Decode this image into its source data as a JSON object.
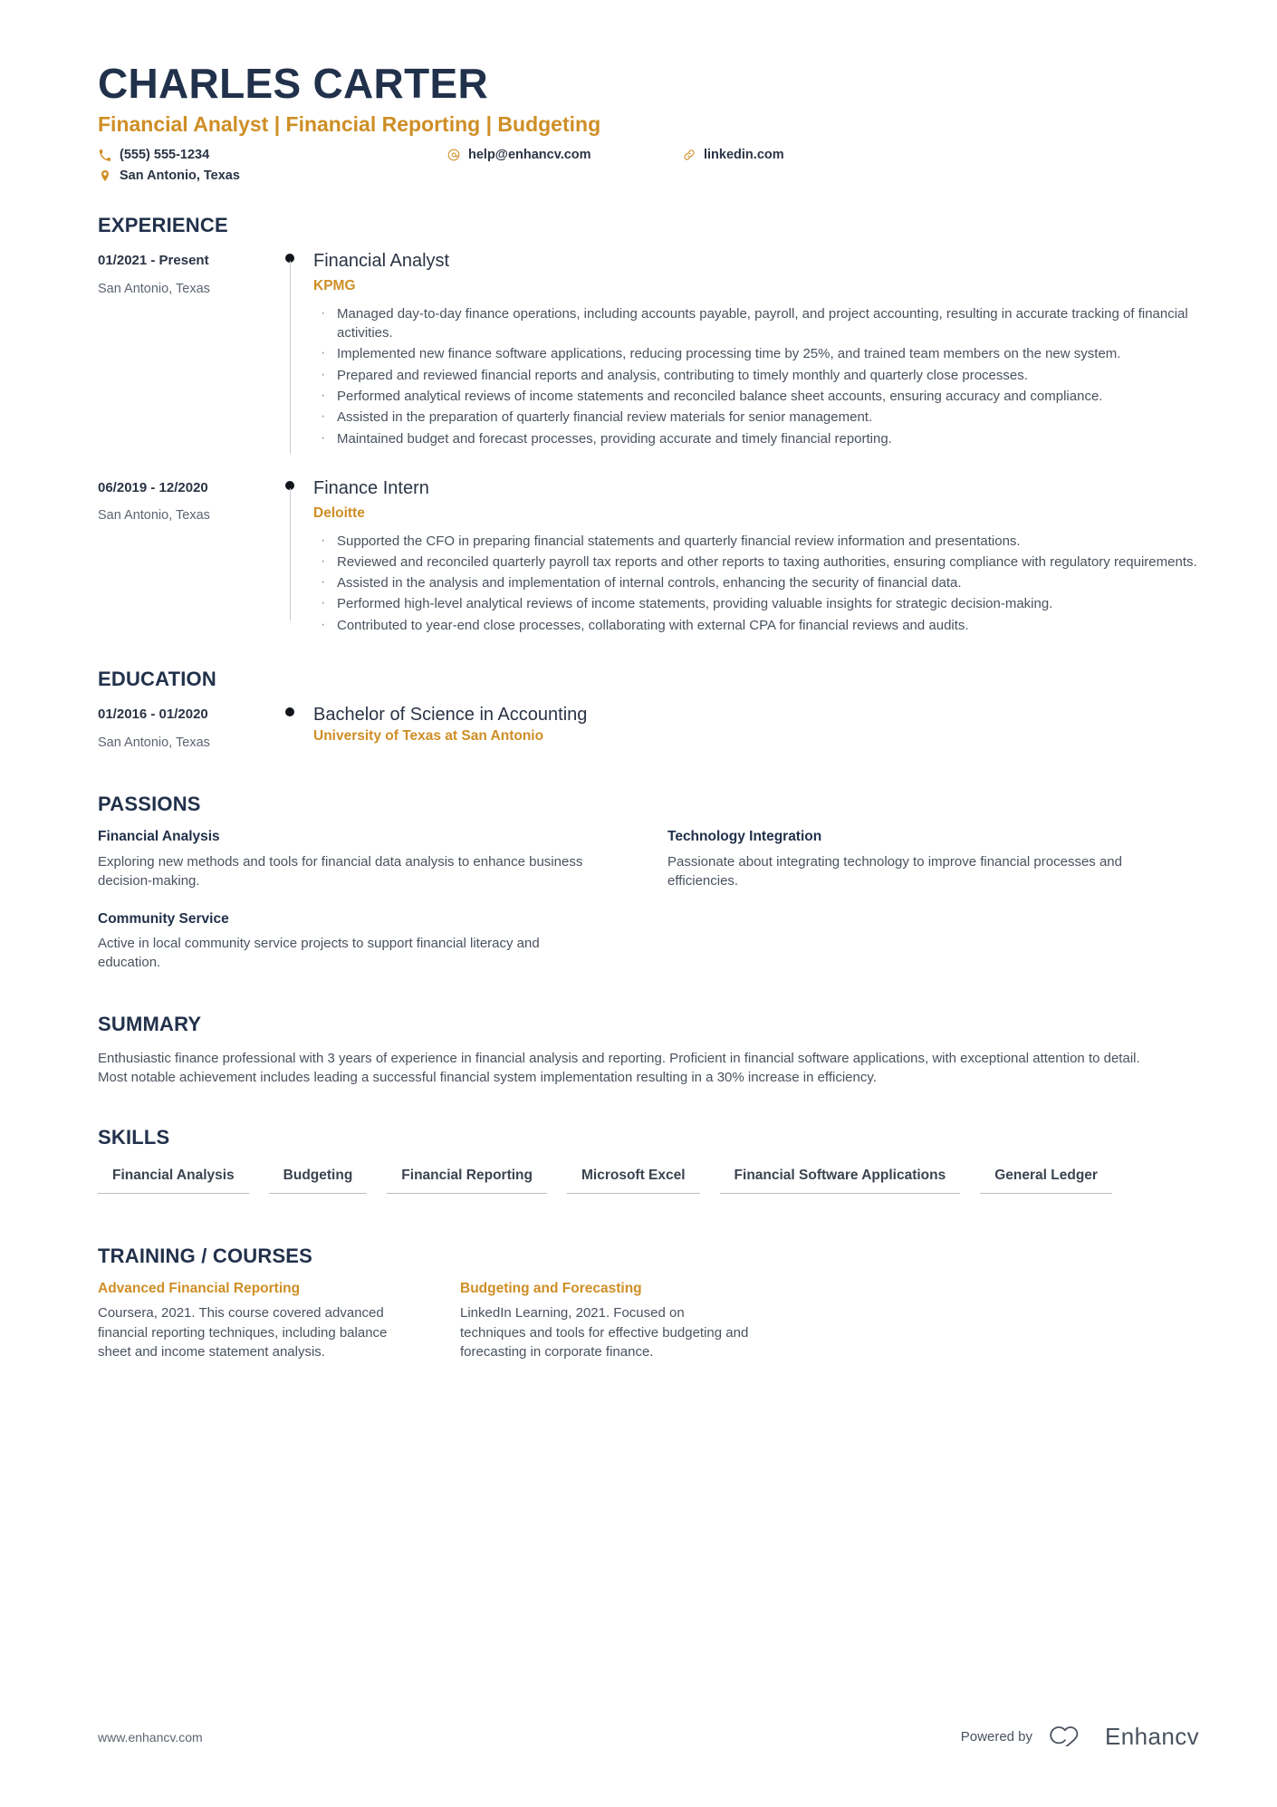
{
  "header": {
    "name": "CHARLES CARTER",
    "tagline": "Financial Analyst | Financial Reporting | Budgeting",
    "contacts": [
      {
        "icon": "phone-icon",
        "value": "(555) 555-1234"
      },
      {
        "icon": "email-icon",
        "value": "help@enhancv.com"
      },
      {
        "icon": "link-icon",
        "value": "linkedin.com"
      },
      {
        "icon": "location-icon",
        "value": "San Antonio, Texas"
      }
    ]
  },
  "experience": {
    "title": "EXPERIENCE",
    "entries": [
      {
        "date": "01/2021 - Present",
        "location": "San Antonio, Texas",
        "role": "Financial Analyst",
        "organization": "KPMG",
        "bullets": [
          "Managed day-to-day finance operations, including accounts payable, payroll, and project accounting, resulting in accurate tracking of financial activities.",
          "Implemented new finance software applications, reducing processing time by 25%, and trained team members on the new system.",
          "Prepared and reviewed financial reports and analysis, contributing to timely monthly and quarterly close processes.",
          "Performed analytical reviews of income statements and reconciled balance sheet accounts, ensuring accuracy and compliance.",
          "Assisted in the preparation of quarterly financial review materials for senior management.",
          "Maintained budget and forecast processes, providing accurate and timely financial reporting."
        ]
      },
      {
        "date": "06/2019 - 12/2020",
        "location": "San Antonio, Texas",
        "role": "Finance Intern",
        "organization": "Deloitte",
        "bullets": [
          "Supported the CFO in preparing financial statements and quarterly financial review information and presentations.",
          "Reviewed and reconciled quarterly payroll tax reports and other reports to taxing authorities, ensuring compliance with regulatory requirements.",
          "Assisted in the analysis and implementation of internal controls, enhancing the security of financial data.",
          "Performed high-level analytical reviews of income statements, providing valuable insights for strategic decision-making.",
          "Contributed to year-end close processes, collaborating with external CPA for financial reviews and audits."
        ]
      }
    ]
  },
  "education": {
    "title": "EDUCATION",
    "entries": [
      {
        "date": "01/2016 - 01/2020",
        "location": "San Antonio, Texas",
        "degree": "Bachelor of Science in Accounting",
        "school": "University of Texas at San Antonio"
      }
    ]
  },
  "passions": {
    "title": "PASSIONS",
    "items": [
      {
        "title": "Financial Analysis",
        "description": "Exploring new methods and tools for financial data analysis to enhance business decision-making."
      },
      {
        "title": "Technology Integration",
        "description": "Passionate about integrating technology to improve financial processes and efficiencies."
      },
      {
        "title": "Community Service",
        "description": "Active in local community service projects to support financial literacy and education."
      }
    ]
  },
  "summary": {
    "title": "SUMMARY",
    "text": "Enthusiastic finance professional with 3 years of experience in financial analysis and reporting. Proficient in financial software applications, with exceptional attention to detail. Most notable achievement includes leading a successful financial system implementation resulting in a 30% increase in efficiency."
  },
  "skills": {
    "title": "SKILLS",
    "items": [
      "Financial Analysis",
      "Budgeting",
      "Financial Reporting",
      "Microsoft Excel",
      "Financial Software Applications",
      "General Ledger"
    ]
  },
  "training": {
    "title": "TRAINING / COURSES",
    "items": [
      {
        "title": "Advanced Financial Reporting",
        "description": "Coursera, 2021. This course covered advanced financial reporting techniques, including balance sheet and income statement analysis."
      },
      {
        "title": "Budgeting and Forecasting",
        "description": "LinkedIn Learning, 2021. Focused on techniques and tools for effective budgeting and forecasting in corporate finance."
      }
    ]
  },
  "footer": {
    "url": "www.enhancv.com",
    "powered_by": "Powered by",
    "brand": "Enhancv"
  },
  "colors": {
    "accent": "#cf8e25",
    "heading": "#22314b",
    "body": "#4a525e"
  }
}
